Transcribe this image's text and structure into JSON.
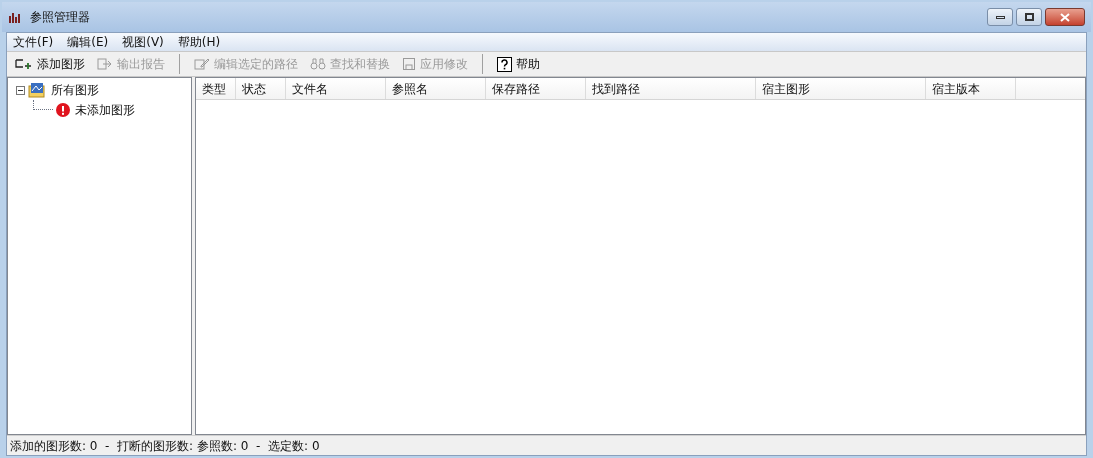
{
  "window": {
    "title": "参照管理器"
  },
  "menu": [
    "文件(F)",
    "编辑(E)",
    "视图(V)",
    "帮助(H)"
  ],
  "toolbar": [
    {
      "kind": "add",
      "label": "添加图形",
      "disabled": false
    },
    {
      "kind": "export",
      "label": "输出报告",
      "disabled": true
    },
    {
      "kind": "separator"
    },
    {
      "kind": "edit",
      "label": "编辑选定的路径",
      "disabled": true
    },
    {
      "kind": "find",
      "label": "查找和替换",
      "disabled": true
    },
    {
      "kind": "apply",
      "label": "应用修改",
      "disabled": true
    },
    {
      "kind": "separator"
    },
    {
      "kind": "help",
      "label": "帮助",
      "disabled": false
    }
  ],
  "tree": [
    {
      "label": "所有图形",
      "kind": "drawings",
      "expanded": true,
      "children": [
        {
          "label": "未添加图形",
          "kind": "error"
        }
      ]
    }
  ],
  "table": {
    "columns": [
      "类型",
      "状态",
      "文件名",
      "参照名",
      "保存路径",
      "找到路径",
      "宿主图形",
      "宿主版本"
    ]
  },
  "status_bar": "添加的图形数: 0  -  打断的图形数: 参照数: 0  -  选定数: 0"
}
